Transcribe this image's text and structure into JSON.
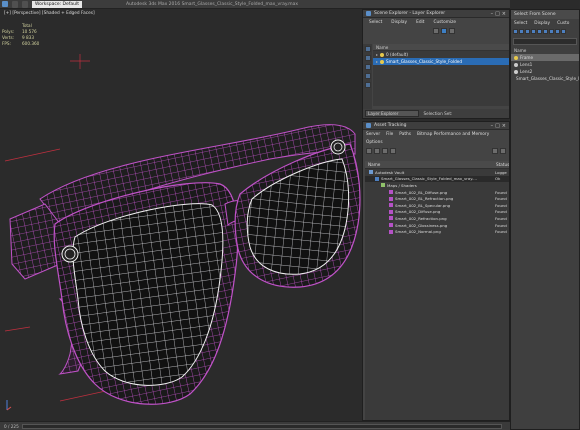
{
  "titlebar": {
    "btn1": "",
    "btn2": "",
    "workspace_label": "Workspace: Default",
    "title": "Autodesk 3ds Max 2016    Smart_Glasses_Classic_Style_Folded_max_vray.max"
  },
  "viewport": {
    "label": "[+] [Perspective] [Shaded + Edged Faces]",
    "stats": [
      {
        "k": "",
        "v": "Total"
      },
      {
        "k": "Polys:",
        "v": "10 576"
      },
      {
        "k": "Verts:",
        "v": "9 833"
      },
      {
        "k": "",
        "v": ""
      },
      {
        "k": "FPS:",
        "v": "600.360"
      }
    ]
  },
  "statusbar": {
    "text": "0 / 225"
  },
  "scene_explorer": {
    "title": "Scene Explorer - Layer Explorer",
    "menu": [
      "Select",
      "Display",
      "Edit",
      "Customize"
    ],
    "column": "Name",
    "rows": [
      {
        "label": "0 (default)",
        "selected": false
      },
      {
        "label": "Smart_Glasses_Classic_Style_Folded",
        "selected": true
      }
    ],
    "footer_dropdown": "Layer Explorer",
    "footer_label": "Selection Set:"
  },
  "asset_tracking": {
    "title": "Asset Tracking",
    "menu": [
      "Server",
      "File",
      "Paths",
      "Bitmap Performance and Memory",
      "Options"
    ],
    "columns": {
      "name": "Name",
      "status": "Status"
    },
    "rows": [
      {
        "name": "Autodesk Vault",
        "status": "Logge",
        "indent": 4,
        "icon": "vault"
      },
      {
        "name": "Smart_Glasses_Classic_Style_Folded_max_vray....",
        "status": "Ok",
        "indent": 10,
        "icon": "max"
      },
      {
        "name": "Maps / Shaders",
        "status": "",
        "indent": 16,
        "icon": "map"
      },
      {
        "name": "Smart_002_BL_Diffuse.png",
        "status": "Found",
        "indent": 24,
        "icon": "file"
      },
      {
        "name": "Smart_002_BL_Refraction.png",
        "status": "Found",
        "indent": 24,
        "icon": "file"
      },
      {
        "name": "Smart_002_BL_Specular.png",
        "status": "Found",
        "indent": 24,
        "icon": "file"
      },
      {
        "name": "Smart_002_Diffuse.png",
        "status": "Found",
        "indent": 24,
        "icon": "file"
      },
      {
        "name": "Smart_002_Refraction.png",
        "status": "Found",
        "indent": 24,
        "icon": "file"
      },
      {
        "name": "Smart_002_Glossiness.png",
        "status": "Found",
        "indent": 24,
        "icon": "file"
      },
      {
        "name": "Smart_002_Normal.png",
        "status": "Found",
        "indent": 24,
        "icon": "file"
      }
    ]
  },
  "select_from_scene": {
    "title": "Select From Scene",
    "menu": [
      "Select",
      "Display",
      "Custo"
    ],
    "column": "Name",
    "rows": [
      {
        "label": "Frame",
        "selected": true,
        "icon": "bulb"
      },
      {
        "label": "Lens1",
        "selected": false,
        "icon": "eye"
      },
      {
        "label": "Lens2",
        "selected": false,
        "icon": "eye"
      },
      {
        "label": "Smart_Glasses_Classic_Style_Folded",
        "selected": false,
        "icon": "bulb"
      }
    ]
  },
  "colors": {
    "wire": "#c052c8",
    "frame_fill": "#222222",
    "selection_blue": "#2a6cb5"
  }
}
